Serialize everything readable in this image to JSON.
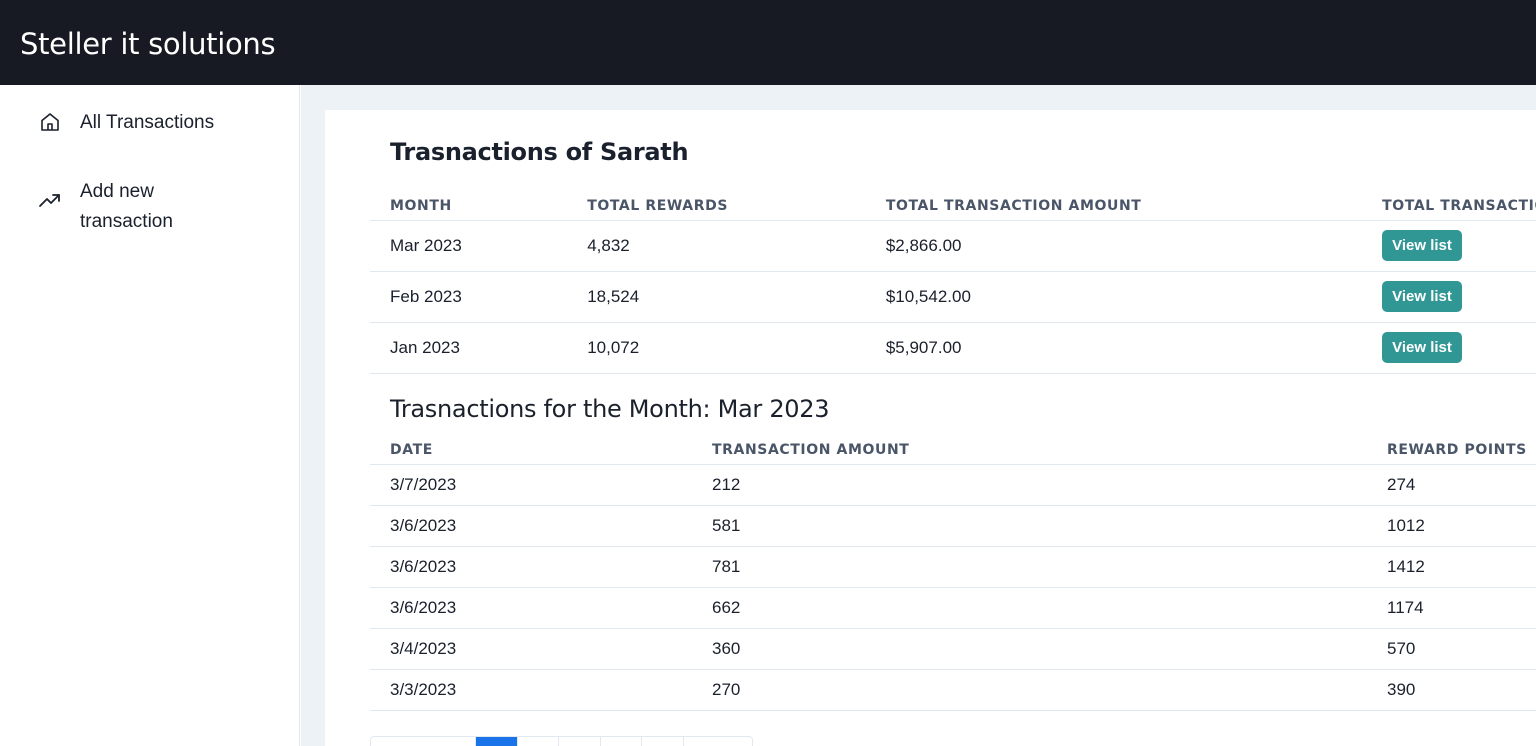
{
  "app": {
    "title": "Steller it solutions"
  },
  "sidebar": {
    "items": [
      {
        "label": "All Transactions",
        "icon": "home-icon"
      },
      {
        "label": "Add new transaction",
        "icon": "trending-up-icon"
      }
    ]
  },
  "summary": {
    "title": "Trasnactions of Sarath",
    "columns": [
      "MONTH",
      "TOTAL REWARDS",
      "TOTAL TRANSACTION AMOUNT",
      "TOTAL TRANSACTIONS"
    ],
    "rows": [
      {
        "month": "Mar 2023",
        "rewards": "4,832",
        "amount": "$2,866.00",
        "action": "View list"
      },
      {
        "month": "Feb 2023",
        "rewards": "18,524",
        "amount": "$10,542.00",
        "action": "View list"
      },
      {
        "month": "Jan 2023",
        "rewards": "10,072",
        "amount": "$5,907.00",
        "action": "View list"
      }
    ]
  },
  "monthly": {
    "title": "Trasnactions for the Month: Mar 2023",
    "columns": [
      "DATE",
      "TRANSACTION AMOUNT",
      "REWARD POINTS"
    ],
    "rows": [
      {
        "date": "3/7/2023",
        "amount": "212",
        "points": "274"
      },
      {
        "date": "3/6/2023",
        "amount": "581",
        "points": "1012"
      },
      {
        "date": "3/6/2023",
        "amount": "781",
        "points": "1412"
      },
      {
        "date": "3/6/2023",
        "amount": "662",
        "points": "1174"
      },
      {
        "date": "3/4/2023",
        "amount": "360",
        "points": "570"
      },
      {
        "date": "3/3/2023",
        "amount": "270",
        "points": "390"
      }
    ]
  },
  "colors": {
    "topbar": "#171923",
    "accent": "#319795",
    "pager_active": "#1a73e8"
  }
}
